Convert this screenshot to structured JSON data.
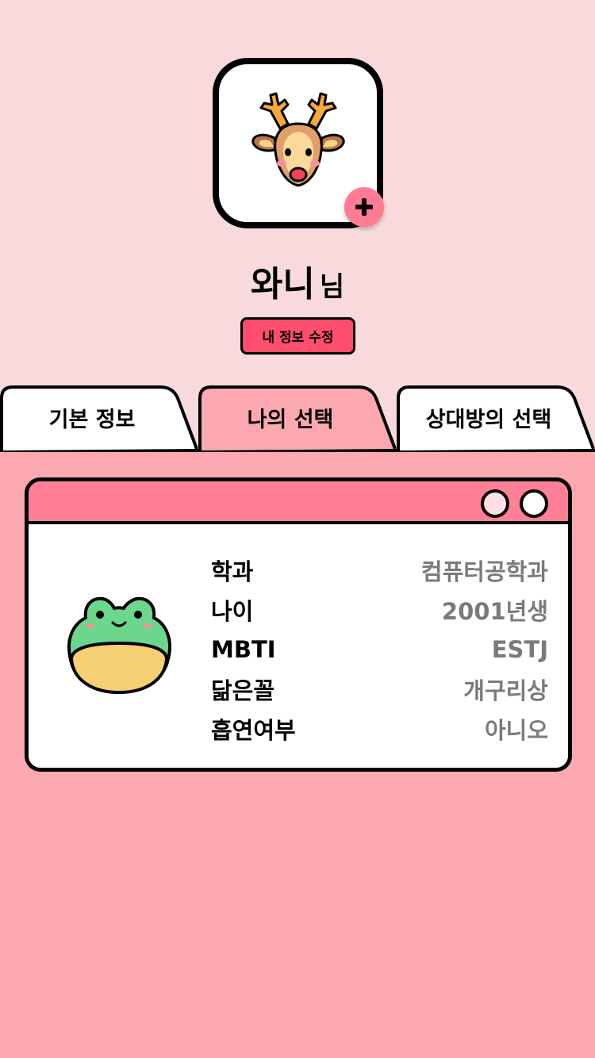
{
  "profile": {
    "name": "와니",
    "suffix": "님",
    "avatar_icon": "reindeer-icon",
    "add_icon": "plus-icon",
    "edit_label": "내 정보 수정"
  },
  "tabs": [
    {
      "label": "기본 정보",
      "active": false
    },
    {
      "label": "나의 선택",
      "active": true
    },
    {
      "label": "상대방의 선택",
      "active": false
    }
  ],
  "card": {
    "icon": "frog-icon",
    "rows": [
      {
        "key": "학과",
        "value": "컴퓨터공학과"
      },
      {
        "key": "나이",
        "value": "2001년생"
      },
      {
        "key": "MBTI",
        "value": "ESTJ"
      },
      {
        "key": "닮은꼴",
        "value": "개구리상"
      },
      {
        "key": "흡연여부",
        "value": "아니오"
      }
    ]
  },
  "colors": {
    "top_background": "#f8dadd",
    "bottom_background": "#fba8b0",
    "accent": "#ff7c93",
    "edit_button": "#ff4d6d",
    "active_tab": "#fba8b0"
  }
}
